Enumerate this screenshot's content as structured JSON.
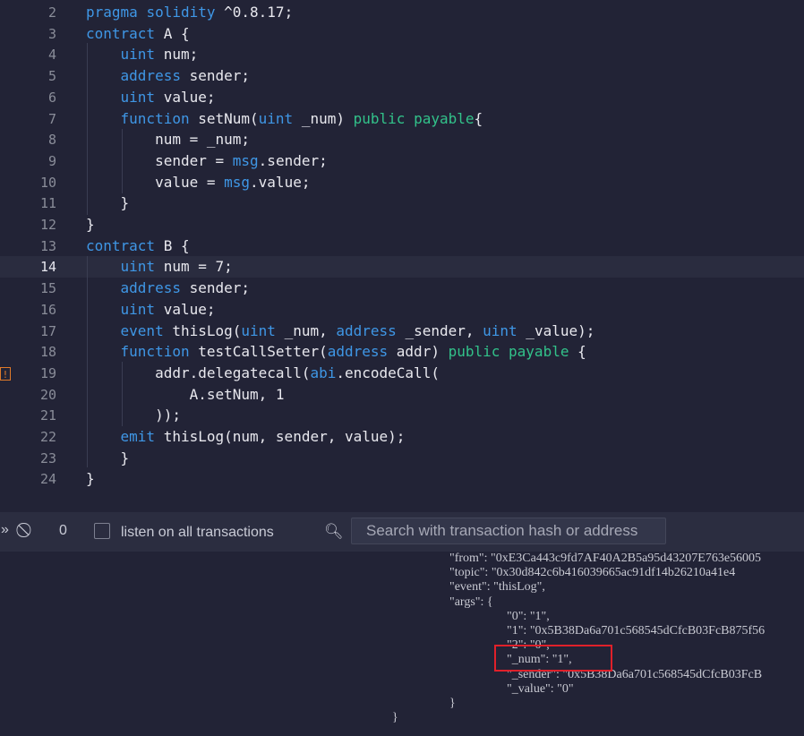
{
  "editor": {
    "lines": [
      {
        "n": "2",
        "text": "pragma solidity ^0.8.17;"
      },
      {
        "n": "3",
        "text": "contract A {"
      },
      {
        "n": "4",
        "text": "    uint num;"
      },
      {
        "n": "5",
        "text": "    address sender;"
      },
      {
        "n": "6",
        "text": "    uint value;"
      },
      {
        "n": "7",
        "text": "    function setNum(uint _num) public payable{"
      },
      {
        "n": "8",
        "text": "        num = _num;"
      },
      {
        "n": "9",
        "text": "        sender = msg.sender;"
      },
      {
        "n": "10",
        "text": "        value = msg.value;"
      },
      {
        "n": "11",
        "text": "    }"
      },
      {
        "n": "12",
        "text": "}"
      },
      {
        "n": "13",
        "text": "contract B {"
      },
      {
        "n": "14",
        "text": "    uint num = 7;"
      },
      {
        "n": "15",
        "text": "    address sender;"
      },
      {
        "n": "16",
        "text": "    uint value;"
      },
      {
        "n": "17",
        "text": "    event thisLog(uint _num, address _sender, uint _value);"
      },
      {
        "n": "18",
        "text": "    function testCallSetter(address addr) public payable {"
      },
      {
        "n": "19",
        "text": "        addr.delegatecall(abi.encodeCall("
      },
      {
        "n": "20",
        "text": "            A.setNum, 1"
      },
      {
        "n": "21",
        "text": "        ));"
      },
      {
        "n": "22",
        "text": "    emit thisLog(num, sender, value);"
      },
      {
        "n": "23",
        "text": "    }"
      },
      {
        "n": "24",
        "text": "}"
      }
    ],
    "current_line": "14",
    "warning_line": "19",
    "warning_glyph": "!"
  },
  "terminal": {
    "count": "0",
    "listen_label": "listen on all transactions",
    "search_placeholder": "Search with transaction hash or address"
  },
  "console": {
    "lines": [
      "\"from\": \"0xE3Ca443c9fd7AF40A2B5a95d43207E763e56005",
      "\"topic\": \"0x30d842c6b416039665ac91df14b26210a41e4",
      "\"event\": \"thisLog\",",
      "\"args\": {",
      "\"0\": \"1\",",
      "\"1\": \"0x5B38Da6a701c568545dCfcB03FcB875f56",
      "\"2\": \"0\",",
      "\"_num\": \"1\",",
      "\"_sender\": \"0x5B38Da6a701c568545dCfcB03FcB",
      "\"_value\": \"0\"",
      "}",
      "}"
    ]
  }
}
